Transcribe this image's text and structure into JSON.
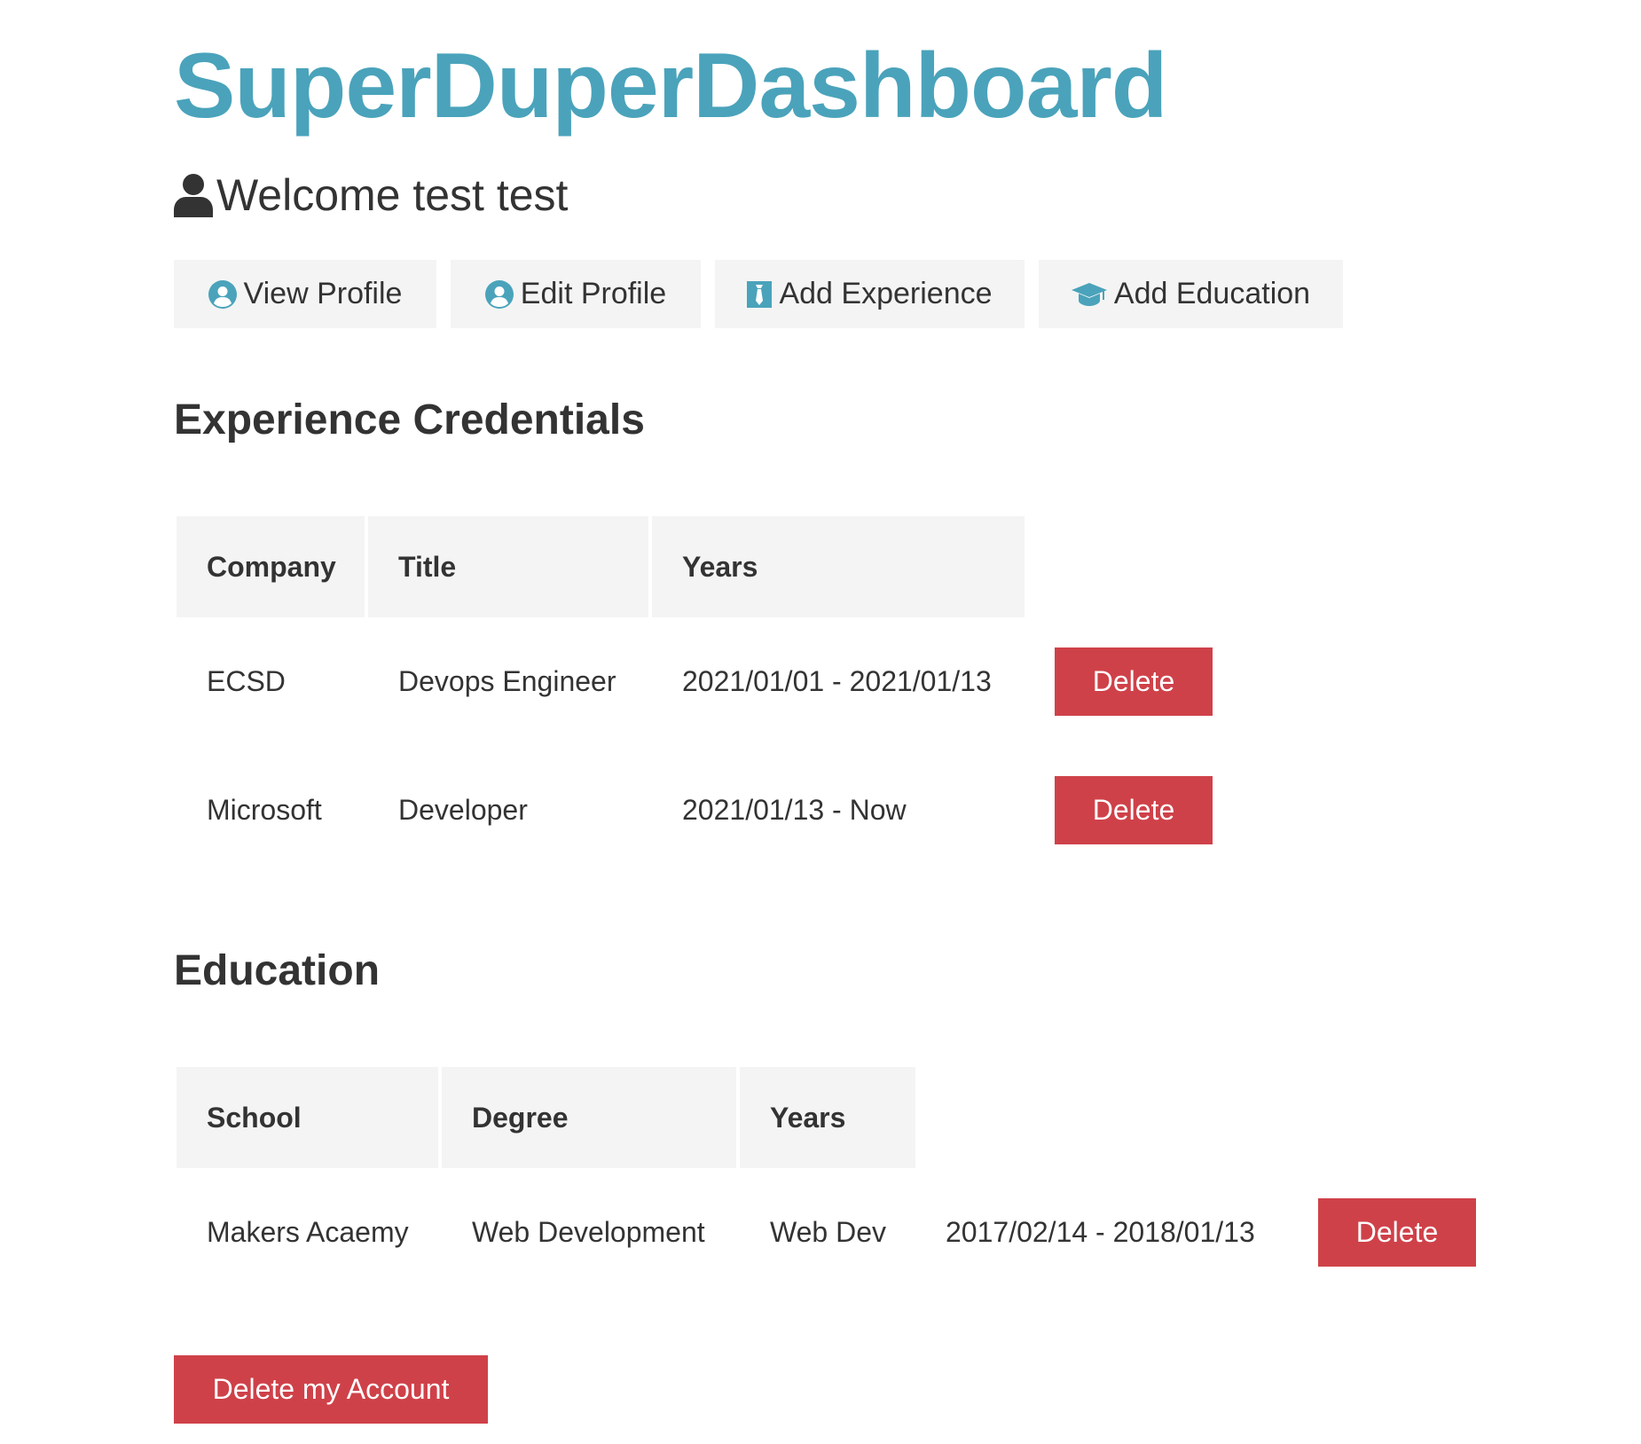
{
  "app": {
    "title": "SuperDuperDashboard"
  },
  "welcome": {
    "text": "Welcome test test",
    "icon": "user-icon"
  },
  "actions": [
    {
      "label": "View Profile",
      "icon": "user-circle-icon"
    },
    {
      "label": "Edit Profile",
      "icon": "user-circle-icon"
    },
    {
      "label": "Add Experience",
      "icon": "black-tie-icon"
    },
    {
      "label": "Add Education",
      "icon": "graduation-cap-icon"
    }
  ],
  "experience": {
    "title": "Experience Credentials",
    "headers": [
      "Company",
      "Title",
      "Years"
    ],
    "rows": [
      {
        "company": "ECSD",
        "title": "Devops Engineer",
        "years": "2021/01/01 - 2021/01/13",
        "delete_label": "Delete"
      },
      {
        "company": "Microsoft",
        "title": "Developer",
        "years": "2021/01/13 - Now",
        "delete_label": "Delete"
      }
    ]
  },
  "education": {
    "title": "Education",
    "headers": [
      "School",
      "Degree",
      "Years"
    ],
    "rows": [
      {
        "school": "Makers Acaemy",
        "degree": "Web Development",
        "field": "Web Dev",
        "years": "2017/02/14 - 2018/01/13",
        "delete_label": "Delete"
      }
    ]
  },
  "account": {
    "delete_label": "Delete my Account"
  },
  "colors": {
    "brand": "#4aa3bb",
    "danger": "#cf4149",
    "light": "#f4f4f4",
    "text": "#333333"
  }
}
